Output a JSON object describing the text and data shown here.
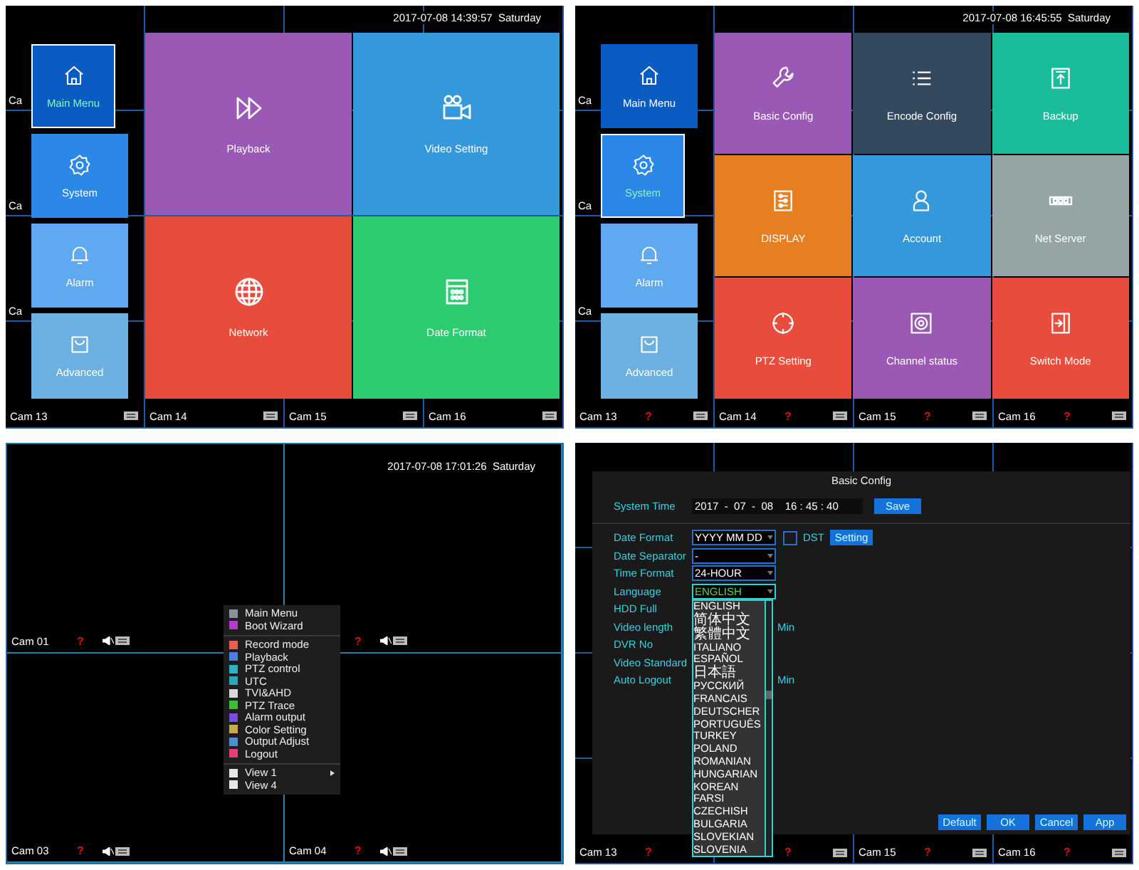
{
  "panels": [
    {
      "kind": "menu",
      "timestamp": "2017-07-08 14:39:57  Saturday",
      "edge_labels": [
        "Ca",
        "Ca",
        "Ca"
      ],
      "side_menu": [
        {
          "label": "Main Menu",
          "selected": true,
          "color": "#0a5cc2"
        },
        {
          "label": "System",
          "selected": false,
          "color": "#2b88e6"
        },
        {
          "label": "Alarm",
          "selected": false,
          "color": "#5ea9ef"
        },
        {
          "label": "Advanced",
          "selected": false,
          "color": "#6cb0e2"
        }
      ],
      "tiles": [
        {
          "label": "Playback",
          "color": "#9b59b6"
        },
        {
          "label": "Video Setting",
          "color": "#3498db"
        },
        {
          "label": "Network",
          "color": "#e74c3c"
        },
        {
          "label": "Date Format",
          "color": "#2ecc71"
        }
      ],
      "cams": [
        {
          "label": "Cam 13"
        },
        {
          "label": "Cam 14"
        },
        {
          "label": "Cam 15"
        },
        {
          "label": "Cam 16"
        }
      ]
    },
    {
      "kind": "menu",
      "timestamp": "2017-07-08 16:45:55  Saturday",
      "edge_labels": [
        "Ca",
        "Ca",
        "Ca"
      ],
      "side_menu": [
        {
          "label": "Main Menu",
          "selected": false,
          "color": "#0a5cc2"
        },
        {
          "label": "System",
          "selected": true,
          "color": "#2b88e6"
        },
        {
          "label": "Alarm",
          "selected": false,
          "color": "#5ea9ef"
        },
        {
          "label": "Advanced",
          "selected": false,
          "color": "#6cb0e2"
        }
      ],
      "tiles": [
        {
          "label": "Basic Config",
          "color": "#9b59b6"
        },
        {
          "label": "Encode Config",
          "color": "#34495e"
        },
        {
          "label": "Backup",
          "color": "#1abc9c"
        },
        {
          "label": "DISPLAY",
          "color": "#e67e22"
        },
        {
          "label": "Account",
          "color": "#3498db"
        },
        {
          "label": "Net Server",
          "color": "#95a5a6"
        },
        {
          "label": "PTZ Setting",
          "color": "#e74c3c"
        },
        {
          "label": "Channel status",
          "color": "#9b59b6"
        },
        {
          "label": "Switch Mode",
          "color": "#e74c3c"
        }
      ],
      "cams": [
        {
          "label": "Cam 13",
          "alert": "?"
        },
        {
          "label": "Cam 14",
          "alert": "?"
        },
        {
          "label": "Cam 15",
          "alert": "?"
        },
        {
          "label": "Cam 16",
          "alert": "?"
        }
      ]
    },
    {
      "kind": "live",
      "timestamp": "2017-07-08 17:01:26  Saturday",
      "cams": [
        {
          "label": "Cam 01",
          "alert": "?"
        },
        {
          "alert": "?"
        },
        {
          "label": "Cam 03",
          "alert": "?"
        },
        {
          "label": "Cam 04",
          "alert": "?"
        }
      ],
      "context_menu": {
        "groups": [
          [
            {
              "label": "Main Menu",
              "color": "#8a8f9c"
            },
            {
              "label": "Boot Wizard",
              "color": "#b23ccc"
            }
          ],
          [
            {
              "label": "Record mode",
              "color": "#e8604c"
            },
            {
              "label": "Playback",
              "color": "#4a7ee0"
            },
            {
              "label": "PTZ control",
              "color": "#2ab0c8"
            },
            {
              "label": "UTC",
              "color": "#2aa8b8"
            },
            {
              "label": "TVI&AHD",
              "color": "#d8d8d8"
            },
            {
              "label": "PTZ Trace",
              "color": "#3cbc3c"
            },
            {
              "label": "Alarm output",
              "color": "#7a4ce0"
            },
            {
              "label": "Color Setting",
              "color": "#c8a850"
            },
            {
              "label": "Output Adjust",
              "color": "#4a90d0"
            },
            {
              "label": "Logout",
              "color": "#e83c7a"
            }
          ],
          [
            {
              "label": "View 1",
              "color": "#e6e6e6",
              "submenu": true
            },
            {
              "label": "View 4",
              "color": "#e6e6e6",
              "submenu": false
            }
          ]
        ]
      }
    },
    {
      "kind": "config",
      "cams": [
        {
          "label": "Cam 13",
          "alert": "?"
        },
        {
          "alert": "?"
        },
        {
          "label": "Cam 15",
          "alert": "?"
        },
        {
          "label": "Cam 16",
          "alert": "?"
        }
      ],
      "dialog": {
        "title": "Basic Config",
        "system_time": {
          "label": "System Time",
          "value": "2017  -  07  -  08    16 : 45 : 40",
          "button": "Save"
        },
        "fields": [
          {
            "label": "Date Format",
            "kind": "select",
            "value": "YYYY MM DD",
            "expanded": false,
            "checkbox": {
              "label": "DST",
              "checked": false
            },
            "button": "Setting"
          },
          {
            "label": "Date Separator",
            "kind": "select",
            "value": "-",
            "expanded": false
          },
          {
            "label": "Time Format",
            "kind": "select",
            "value": "24-HOUR",
            "expanded": false
          },
          {
            "label": "Language",
            "kind": "select",
            "value": "ENGLISH",
            "expanded": true,
            "options": [
              "ENGLISH",
              "简体中文",
              "繁體中文",
              "ITALIANO",
              "ESPAÑOL",
              "日本語",
              "РУССКИЙ",
              "FRANCAIS",
              "DEUTSCHER",
              "PORTUGUÊS",
              "TURKEY",
              "POLAND",
              "ROMANIAN",
              "HUNGARIAN",
              "KOREAN",
              "FARSI",
              "CZECHISH",
              "BULGARIA",
              "SLOVEKIAN",
              "SLOVENIA"
            ]
          },
          {
            "label": "HDD Full",
            "kind": "covered"
          },
          {
            "label": "Video length",
            "kind": "covered",
            "unit": "Min"
          },
          {
            "label": "DVR No",
            "kind": "covered"
          },
          {
            "label": "Video Standard",
            "kind": "covered"
          },
          {
            "label": "Auto Logout",
            "kind": "covered",
            "unit": "Min"
          }
        ],
        "buttons": [
          "Default",
          "OK",
          "Cancel",
          "App"
        ]
      }
    }
  ]
}
